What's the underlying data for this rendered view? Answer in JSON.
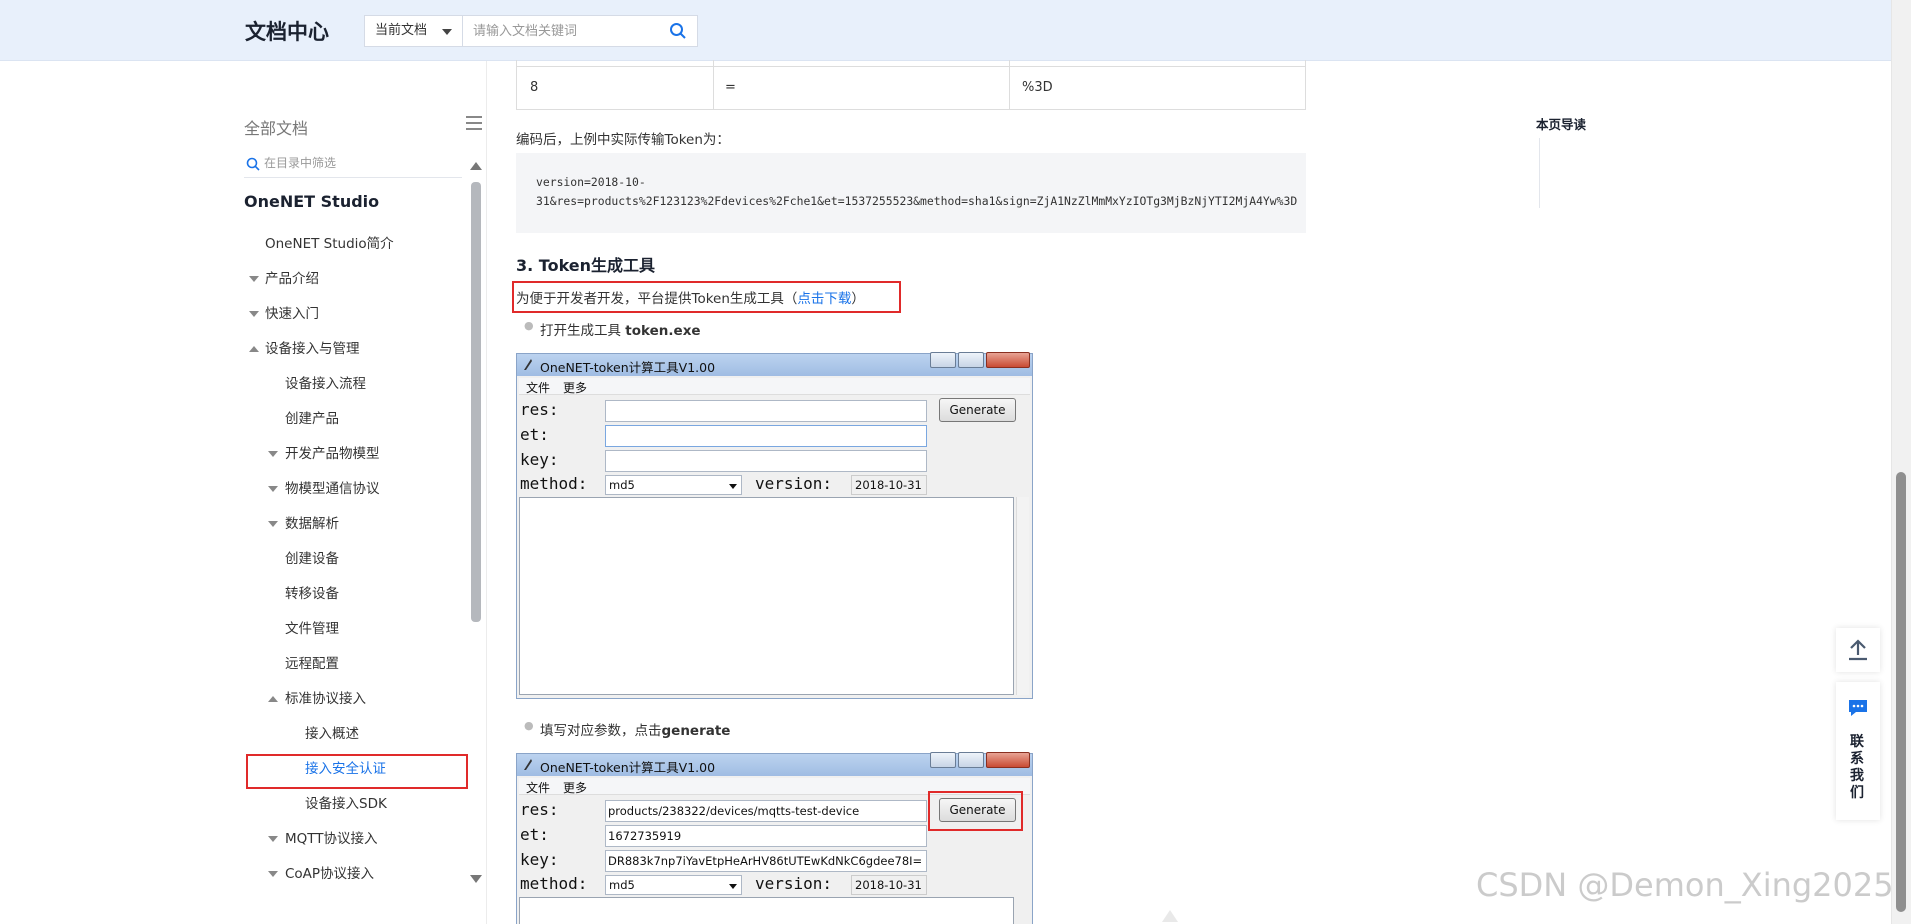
{
  "header": {
    "logo": "文档中心",
    "scope": "当前文档",
    "search_placeholder": "请输入文档关键词"
  },
  "sidebar": {
    "title": "全部文档",
    "filter_placeholder": "在目录中筛选",
    "section": "OneNET Studio",
    "items": [
      {
        "label": "OneNET Studio简介"
      },
      {
        "label": "产品介绍"
      },
      {
        "label": "快速入门"
      },
      {
        "label": "设备接入与管理"
      },
      {
        "label": "设备接入流程"
      },
      {
        "label": "创建产品"
      },
      {
        "label": "开发产品物模型"
      },
      {
        "label": "物模型通信协议"
      },
      {
        "label": "数据解析"
      },
      {
        "label": "创建设备"
      },
      {
        "label": "转移设备"
      },
      {
        "label": "文件管理"
      },
      {
        "label": "远程配置"
      },
      {
        "label": "标准协议接入"
      },
      {
        "label": "接入概述"
      },
      {
        "label": "接入安全认证"
      },
      {
        "label": "设备接入SDK"
      },
      {
        "label": "MQTT协议接入"
      },
      {
        "label": "CoAP协议接入"
      }
    ]
  },
  "content": {
    "table_row": [
      "8",
      "=",
      "%3D"
    ],
    "encoded_intro": "编码后，上例中实际传输Token为：",
    "code_line1": "version=2018-10-",
    "code_line2": "31&res=products%2F123123%2Fdevices%2Fche1&et=1537255523&method=sha1&sign=ZjA1NzZlMmMxYzIOTg3MjBzNjYTI2MjA4Yw%3D",
    "section_heading": "3. Token生成工具",
    "tool_intro": "为便于开发者开发，平台提供Token生成工具（",
    "tool_link": "点击下载",
    "tool_close": "）",
    "step1_prefix": "打开生成工具 ",
    "step1_bold": "token.exe",
    "step2_prefix": "填写对应参数，点击",
    "step2_bold": "generate"
  },
  "tool_window": {
    "title": "OneNET-token计算工具V1.00",
    "menu_file": "文件",
    "menu_more": "更多",
    "label_res": "res:",
    "label_et": "et:",
    "label_key": "key:",
    "label_method": "method:",
    "label_version": "version:",
    "generate": "Generate",
    "method_value": "md5",
    "version_value": "2018-10-31"
  },
  "tool_window2": {
    "res_value": "products/238322/devices/mqtts-test-device",
    "et_value": "1672735919",
    "key_value": "DR883k7np7iYavEtpHeArHV86tUTEwKdNkC6gdee78I="
  },
  "right_nav": {
    "title": "本页导读"
  },
  "float": {
    "contact": "联系我们"
  },
  "watermark": "CSDN @Demon_Xing2025"
}
